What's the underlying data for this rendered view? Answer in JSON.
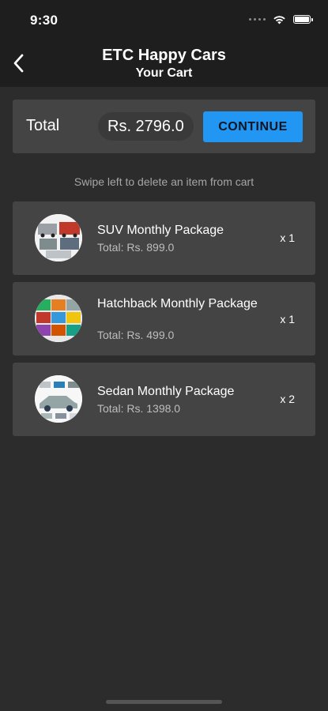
{
  "status_bar": {
    "time": "9:30",
    "icons": [
      "signal-dots-icon",
      "wifi-icon",
      "battery-icon"
    ]
  },
  "header": {
    "title": "ETC Happy Cars",
    "subtitle": "Your Cart",
    "back_icon": "chevron-left-icon"
  },
  "summary": {
    "total_label": "Total",
    "total_amount": "Rs. 2796.0",
    "continue_label": "CONTINUE"
  },
  "hint": "Swipe left to delete an item from cart",
  "items": [
    {
      "name": "SUV Monthly Package",
      "total": "Total: Rs. 899.0",
      "qty": "x 1"
    },
    {
      "name": "Hatchback Monthly Package",
      "total": "Total: Rs. 499.0",
      "qty": "x 1"
    },
    {
      "name": "Sedan Monthly Package",
      "total": "Total: Rs. 1398.0",
      "qty": "x 2"
    }
  ],
  "colors": {
    "background": "#2c2c2c",
    "bar": "#1e1e1e",
    "card": "#444444",
    "accent": "#2196f3"
  }
}
